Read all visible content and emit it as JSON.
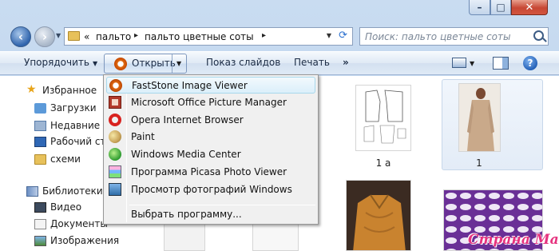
{
  "window": {
    "controls": {
      "minimize": "–",
      "maximize": "□",
      "close": "✕"
    }
  },
  "address_bar": {
    "overflow": "«",
    "segments": [
      "пальто",
      "пальто цветные соты"
    ],
    "separator": "▸"
  },
  "search": {
    "placeholder": "Поиск: пальто цветные соты"
  },
  "toolbar": {
    "organize": "Упорядочить",
    "open": "Открыть",
    "slideshow": "Показ слайдов",
    "print": "Печать",
    "more": "»",
    "help": "?"
  },
  "open_menu": {
    "items": [
      {
        "label": "FastStone Image Viewer",
        "icon": "faststone-icon"
      },
      {
        "label": "Microsoft Office Picture Manager",
        "icon": "picture-manager-icon"
      },
      {
        "label": "Opera Internet Browser",
        "icon": "opera-icon"
      },
      {
        "label": "Paint",
        "icon": "paint-icon"
      },
      {
        "label": "Windows Media Center",
        "icon": "media-center-icon"
      },
      {
        "label": "Программа Picasa Photo Viewer",
        "icon": "picasa-icon"
      },
      {
        "label": "Просмотр фотографий Windows",
        "icon": "windows-photo-viewer-icon"
      }
    ],
    "choose_program": "Выбрать программу..."
  },
  "sidebar": {
    "favorites": "Избранное",
    "downloads": "Загрузки",
    "recent": "Недавние ме",
    "desktop": "Рабочий сто",
    "schemes": "схеми",
    "libraries": "Библиотеки",
    "video": "Видео",
    "documents": "Документы",
    "images": "Изображения"
  },
  "files": [
    {
      "caption": "1 а"
    },
    {
      "caption": "1"
    }
  ],
  "watermark": "Страна Мам",
  "colors": {
    "accent": "#2f64ad",
    "close": "#c74734",
    "watermark": "#e6327e"
  }
}
